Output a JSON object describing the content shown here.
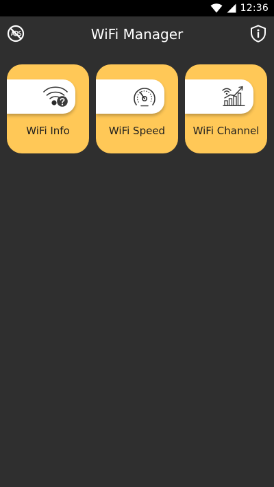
{
  "status_bar": {
    "time": "12:36",
    "icons": [
      "wifi-icon",
      "signal-icon"
    ]
  },
  "app_bar": {
    "title": "WiFi Manager",
    "left_icon": "no-ads-icon",
    "right_icon": "info-shield-icon"
  },
  "cards": [
    {
      "label": "WiFi Info",
      "icon": "wifi-info-icon"
    },
    {
      "label": "WiFi Speed",
      "icon": "speedometer-icon"
    },
    {
      "label": "WiFi Channel",
      "icon": "wifi-chart-icon"
    }
  ],
  "colors": {
    "background": "#2f2f2f",
    "status_bar": "#000000",
    "card": "#ffc857",
    "card_pill": "#ffffff",
    "card_text": "#1e1e1e",
    "title_text": "#ffffff"
  }
}
